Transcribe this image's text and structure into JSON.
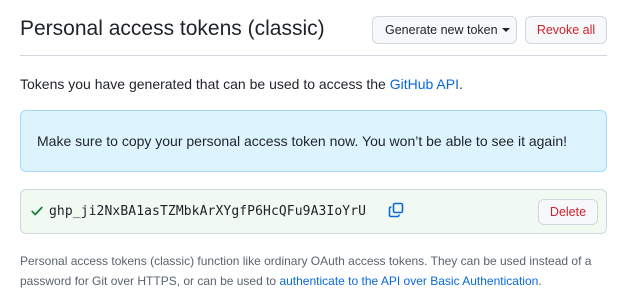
{
  "header": {
    "title": "Personal access tokens (classic)",
    "generate_label": "Generate new token",
    "revoke_label": "Revoke all"
  },
  "intro": {
    "text_before": "Tokens you have generated that can be used to access the ",
    "link_text": "GitHub API",
    "text_after": "."
  },
  "flash": {
    "message": "Make sure to copy your personal access token now. You won’t be able to see it again!"
  },
  "token": {
    "value": "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",
    "delete_label": "Delete",
    "icons": {
      "status": "check-icon",
      "copy": "copy-icon"
    },
    "colors": {
      "check": "#1a7f37",
      "copy": "#0969da"
    }
  },
  "footnote": {
    "text_before": "Personal access tokens (classic) function like ordinary OAuth access tokens. They can be used instead of a password for Git over HTTPS, or can be used to ",
    "link_text": "authenticate to the API over Basic Authentication",
    "text_after": "."
  },
  "colors": {
    "link": "#0969da",
    "danger": "#cf222e",
    "info_bg": "#ddf4ff",
    "success_bg": "#f0faf2"
  }
}
